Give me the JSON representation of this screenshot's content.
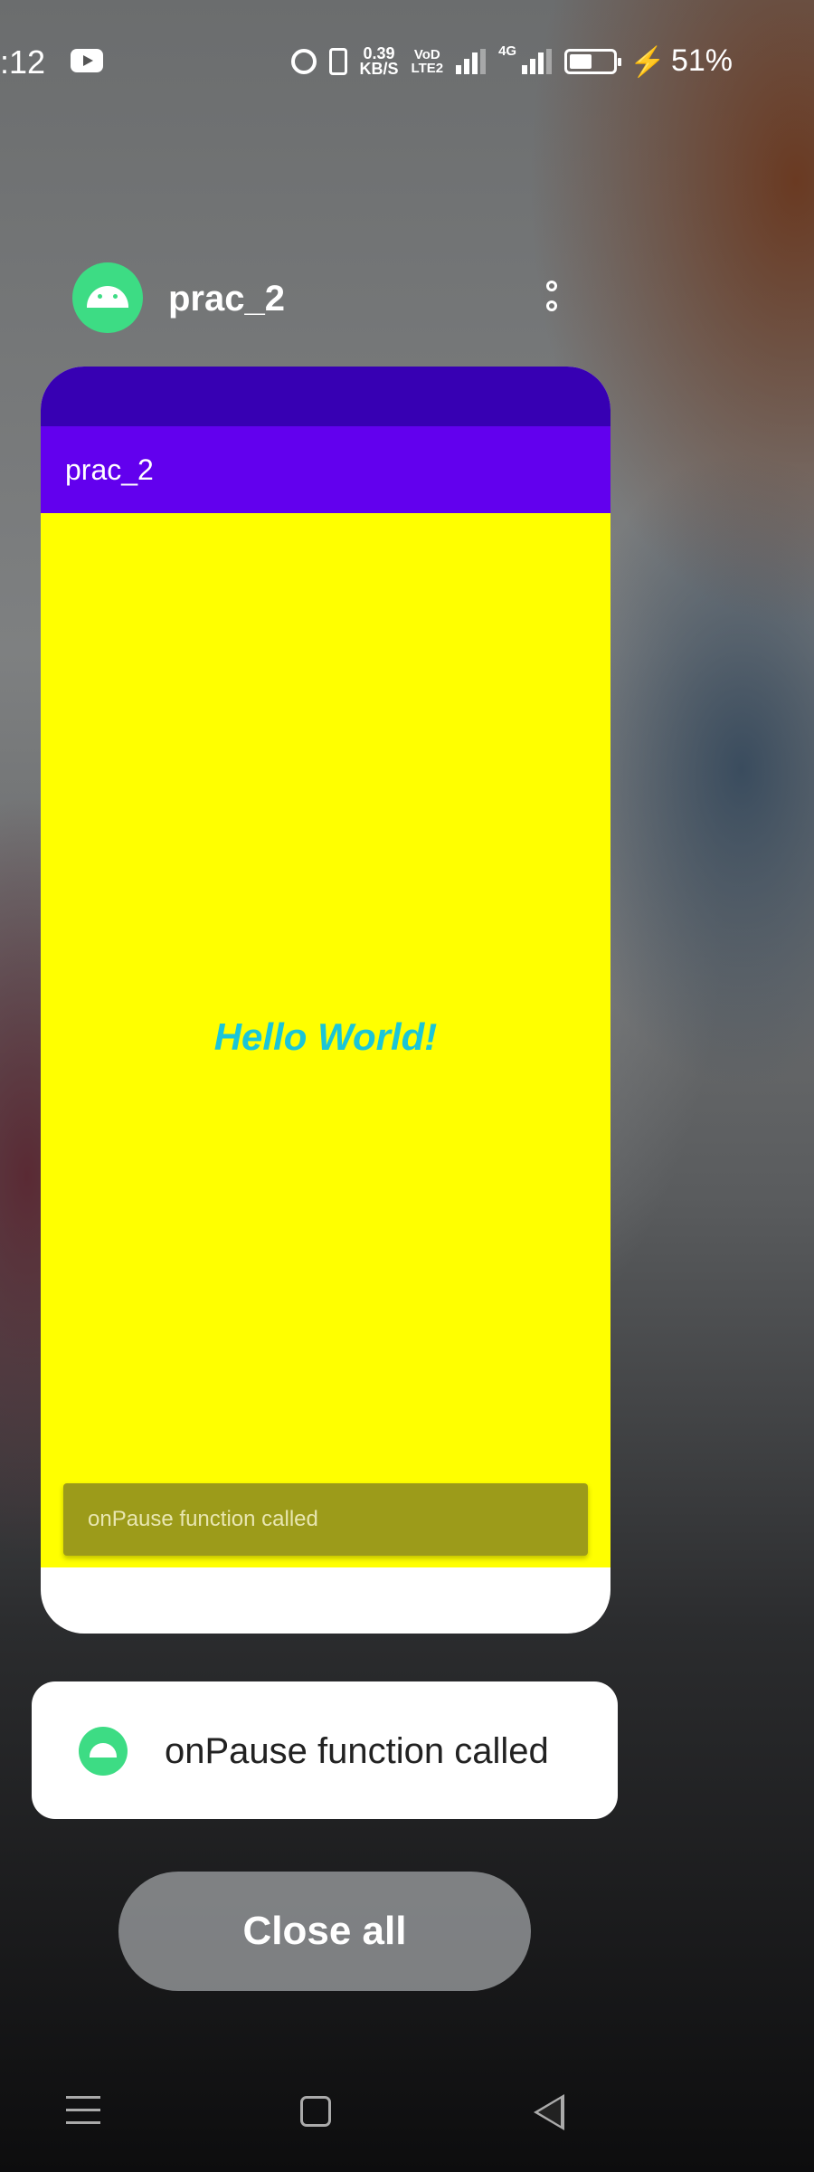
{
  "status_bar": {
    "time": ":12",
    "speed_value": "0.39",
    "speed_unit": "KB/S",
    "volte_top": "VoD",
    "volte_bottom": "LTE2",
    "network_type": "4G",
    "battery": "51%",
    "icons": [
      "youtube-icon",
      "alarm-icon",
      "vibrate-icon",
      "signal-icon",
      "battery-icon",
      "charging-bolt-icon"
    ]
  },
  "recents": {
    "app_title": "prac_2",
    "card": {
      "toolbar_title": "prac_2",
      "hello_text": "Hello World!",
      "snackbar_text": "onPause function called",
      "colors": {
        "status": "#3700b3",
        "toolbar": "#6200ee",
        "content": "#ffff00",
        "hello": "#1ac6d8"
      }
    },
    "toast_text": "onPause function called",
    "close_all_label": "Close all"
  },
  "nav_bar": {
    "icons": [
      "menu-icon",
      "home-icon",
      "back-icon"
    ]
  }
}
